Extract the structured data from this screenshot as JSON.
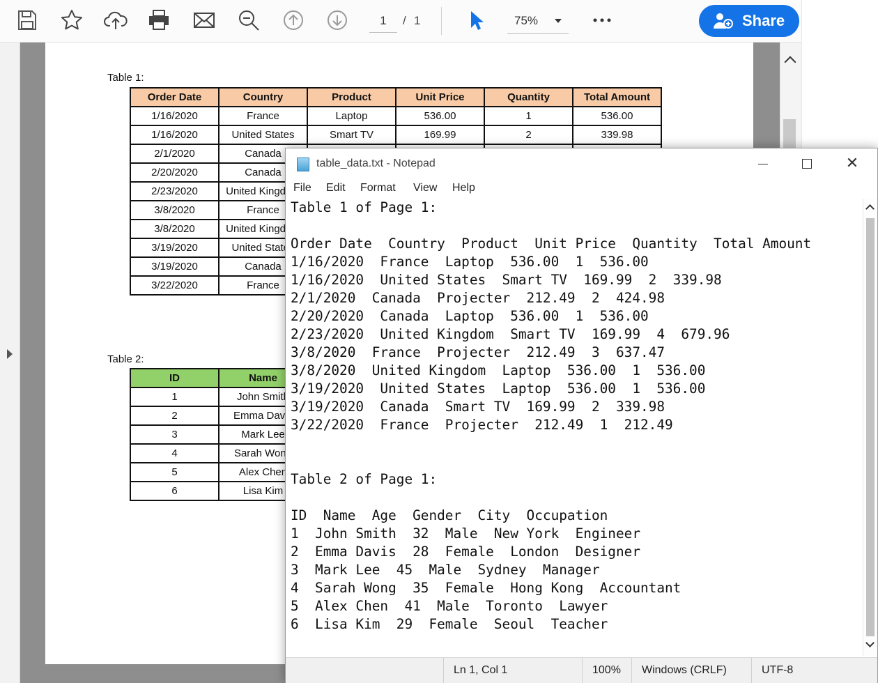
{
  "pdf": {
    "toolbar": {
      "page_current": "1",
      "page_separator": "/",
      "page_total": "1",
      "zoom": "75%",
      "share_label": "Share"
    },
    "table1": {
      "caption": "Table 1:",
      "header_color": "#f8cba6",
      "headers": [
        "Order Date",
        "Country",
        "Product",
        "Unit Price",
        "Quantity",
        "Total Amount"
      ],
      "rows": [
        [
          "1/16/2020",
          "France",
          "Laptop",
          "536.00",
          "1",
          "536.00"
        ],
        [
          "1/16/2020",
          "United States",
          "Smart TV",
          "169.99",
          "2",
          "339.98"
        ],
        [
          "2/1/2020",
          "Canada"
        ],
        [
          "2/20/2020",
          "Canada"
        ],
        [
          "2/23/2020",
          "United Kingdom"
        ],
        [
          "3/8/2020",
          "France"
        ],
        [
          "3/8/2020",
          "United Kingdom"
        ],
        [
          "3/19/2020",
          "United States"
        ],
        [
          "3/19/2020",
          "Canada"
        ],
        [
          "3/22/2020",
          "France"
        ]
      ]
    },
    "table2": {
      "caption": "Table 2:",
      "header_color": "#92d06a",
      "headers": [
        "ID",
        "Name"
      ],
      "rows": [
        [
          "1",
          "John Smith"
        ],
        [
          "2",
          "Emma Davis"
        ],
        [
          "3",
          "Mark Lee"
        ],
        [
          "4",
          "Sarah Wong"
        ],
        [
          "5",
          "Alex Chen"
        ],
        [
          "6",
          "Lisa Kim"
        ]
      ]
    }
  },
  "notepad": {
    "title": "table_data.txt - Notepad",
    "menu": [
      "File",
      "Edit",
      "Format",
      "View",
      "Help"
    ],
    "lines": [
      "Table 1 of Page 1:",
      "",
      "Order Date  Country  Product  Unit Price  Quantity  Total Amount",
      "1/16/2020  France  Laptop  536.00  1  536.00",
      "1/16/2020  United States  Smart TV  169.99  2  339.98",
      "2/1/2020  Canada  Projecter  212.49  2  424.98",
      "2/20/2020  Canada  Laptop  536.00  1  536.00",
      "2/23/2020  United Kingdom  Smart TV  169.99  4  679.96",
      "3/8/2020  France  Projecter  212.49  3  637.47",
      "3/8/2020  United Kingdom  Laptop  536.00  1  536.00",
      "3/19/2020  United States  Laptop  536.00  1  536.00",
      "3/19/2020  Canada  Smart TV  169.99  2  339.98",
      "3/22/2020  France  Projecter  212.49  1  212.49",
      "",
      "",
      "Table 2 of Page 1:",
      "",
      "ID  Name  Age  Gender  City  Occupation",
      "1  John Smith  32  Male  New York  Engineer",
      "2  Emma Davis  28  Female  London  Designer",
      "3  Mark Lee  45  Male  Sydney  Manager",
      "4  Sarah Wong  35  Female  Hong Kong  Accountant",
      "5  Alex Chen  41  Male  Toronto  Lawyer",
      "6  Lisa Kim  29  Female  Seoul  Teacher"
    ],
    "status": {
      "position": "Ln 1, Col 1",
      "zoom": "100%",
      "line_endings": "Windows (CRLF)",
      "encoding": "UTF-8"
    }
  },
  "colors": {
    "share_button": "#1473e6",
    "cursor_tool": "#1473e6"
  }
}
